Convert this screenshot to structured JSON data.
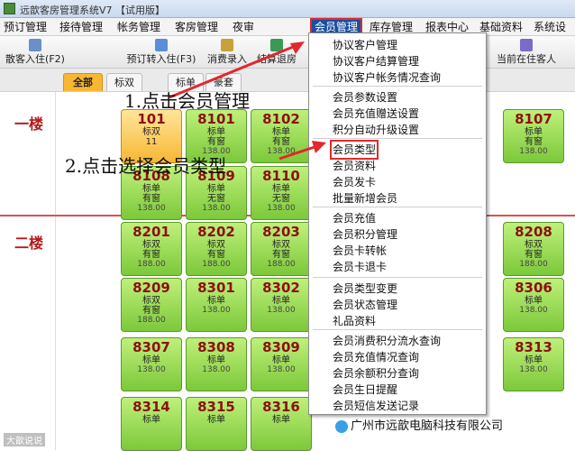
{
  "window": {
    "title": "远歆客房管理系统V7 【试用版】"
  },
  "menu": [
    "预订管理",
    "接待管理",
    "帐务管理",
    "客房管理",
    "夜审",
    "会员管理",
    "库存管理",
    "报表中心",
    "基础资料",
    "系统设置"
  ],
  "toolbar": {
    "walkin": "散客入住(F2)",
    "booking": "预订转入住(F3)",
    "consume": "消费录入",
    "checkout": "结算退房",
    "current": "当前在住客人"
  },
  "tabs": [
    "全部",
    "标双",
    "标单",
    "豪套"
  ],
  "floors": [
    "一楼",
    "二楼"
  ],
  "rooms_row1": [
    {
      "no": "101",
      "type": "标双",
      "extra": "11",
      "sel": true
    },
    {
      "no": "8101",
      "type": "标单",
      "extra": "有窗",
      "price": "138.00"
    },
    {
      "no": "8102",
      "type": "标单",
      "extra": "有窗",
      "price": "138.00"
    },
    {
      "no": "8107",
      "type": "标单",
      "extra": "有窗",
      "price": "138.00"
    }
  ],
  "rooms_row2": [
    {
      "no": "8108",
      "type": "标单",
      "extra": "有窗",
      "price": "138.00"
    },
    {
      "no": "8109",
      "type": "标单",
      "extra": "无窗",
      "price": "138.00"
    },
    {
      "no": "8110",
      "type": "标单",
      "extra": "无窗",
      "price": "138.00"
    }
  ],
  "rooms_row3": [
    {
      "no": "8201",
      "type": "标双",
      "extra": "有窗",
      "price": "188.00"
    },
    {
      "no": "8202",
      "type": "标双",
      "extra": "有窗",
      "price": "188.00"
    },
    {
      "no": "8203",
      "type": "标双",
      "extra": "有窗",
      "price": "188.00"
    },
    {
      "no": "8208",
      "type": "标双",
      "extra": "有窗",
      "price": "188.00"
    }
  ],
  "rooms_row4": [
    {
      "no": "8209",
      "type": "标双",
      "extra": "有窗",
      "price": "188.00"
    },
    {
      "no": "8301",
      "type": "标单",
      "extra": "",
      "price": "138.00"
    },
    {
      "no": "8302",
      "type": "标单",
      "extra": "",
      "price": "138.00"
    },
    {
      "no": "8306",
      "type": "标单",
      "extra": "",
      "price": "138.00"
    }
  ],
  "rooms_row5": [
    {
      "no": "8307",
      "type": "标单",
      "extra": "",
      "price": "138.00"
    },
    {
      "no": "8308",
      "type": "标单",
      "extra": "",
      "price": "138.00"
    },
    {
      "no": "8309",
      "type": "标单",
      "extra": "",
      "price": "138.00"
    },
    {
      "no": "8313",
      "type": "标单",
      "extra": "",
      "price": "138.00"
    }
  ],
  "rooms_row6": [
    {
      "no": "8314",
      "type": "标单",
      "extra": "",
      "price": ""
    },
    {
      "no": "8315",
      "type": "标单",
      "extra": "",
      "price": ""
    },
    {
      "no": "8316",
      "type": "标单",
      "extra": "",
      "price": ""
    }
  ],
  "dropdown": [
    "协议客户管理",
    "协议客户结算管理",
    "协议客户帐务情况查询",
    "会员参数设置",
    "会员充值赠送设置",
    "积分自动升级设置",
    "会员类型",
    "会员资料",
    "会员发卡",
    "批量新增会员",
    "会员充值",
    "会员积分管理",
    "会员卡转帐",
    "会员卡退卡",
    "会员类型变更",
    "会员状态管理",
    "礼品资料",
    "会员消费积分流水查询",
    "会员充值情况查询",
    "会员余额积分查询",
    "会员生日提醒",
    "会员短信发送记录"
  ],
  "notes": {
    "step1": "1.点击会员管理",
    "step2": "2.点击选择会员类型"
  },
  "watermark": "广州市远歆电脑科技有限公司",
  "corner": "大歆说说"
}
